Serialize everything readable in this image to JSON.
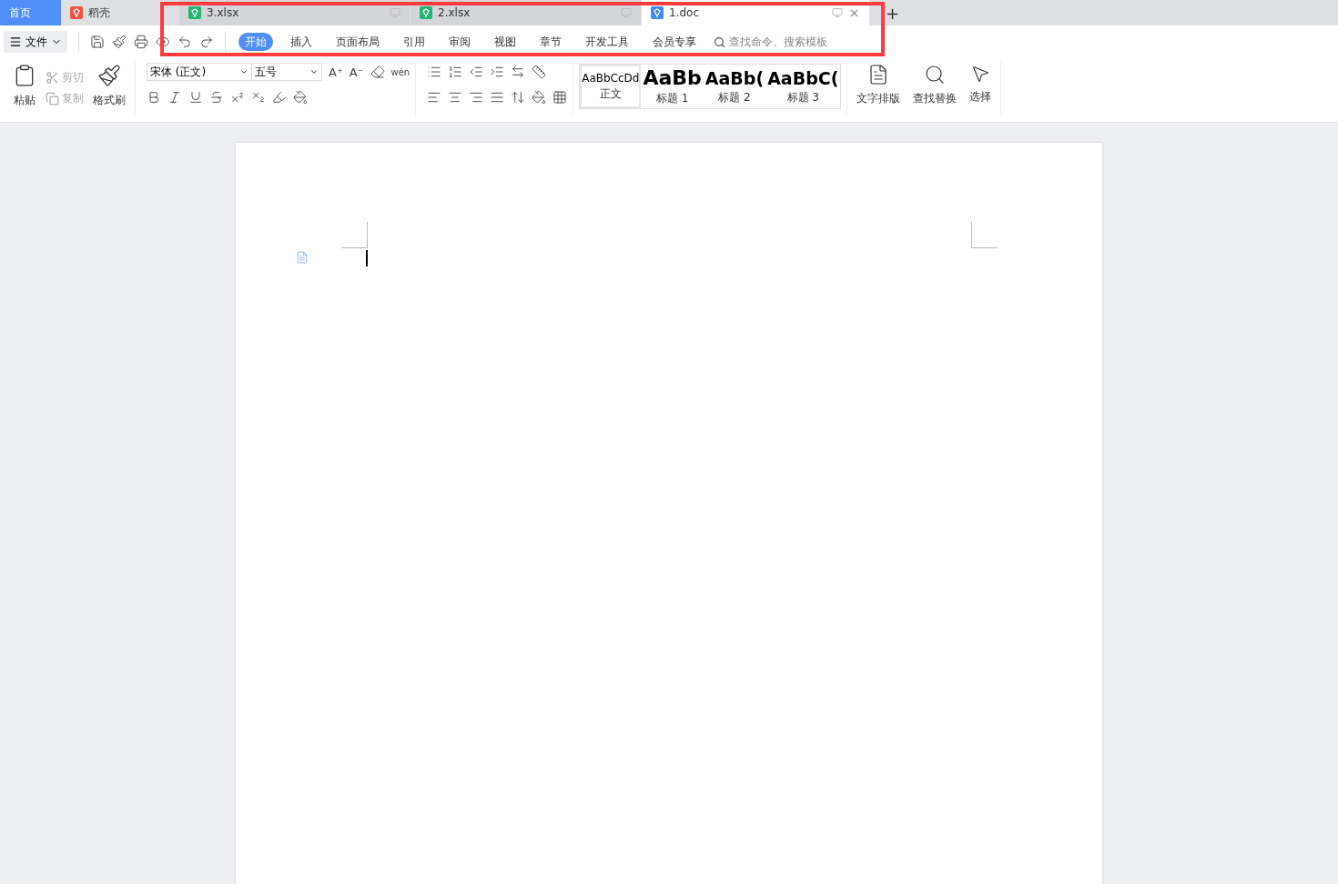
{
  "tabs": [
    {
      "kind": "home",
      "label": "首页",
      "selected": false
    },
    {
      "kind": "app",
      "label": "稻壳",
      "selected": false
    },
    {
      "kind": "sheet",
      "label": "3.xlsx",
      "selected": false
    },
    {
      "kind": "sheet",
      "label": "2.xlsx",
      "selected": false
    },
    {
      "kind": "writer",
      "label": "1.doc",
      "selected": true
    }
  ],
  "new_tab": "+",
  "file_menu": "文件",
  "menu": [
    {
      "label": "开始",
      "selected": true
    },
    {
      "label": "插入",
      "selected": false
    },
    {
      "label": "页面布局",
      "selected": false
    },
    {
      "label": "引用",
      "selected": false
    },
    {
      "label": "审阅",
      "selected": false
    },
    {
      "label": "视图",
      "selected": false
    },
    {
      "label": "章节",
      "selected": false
    },
    {
      "label": "开发工具",
      "selected": false
    },
    {
      "label": "会员专享",
      "selected": false
    }
  ],
  "search": {
    "placeholder": "查找命令、搜索模板"
  },
  "clipboard": {
    "paste": "粘贴",
    "cut": "剪切",
    "copy": "复制",
    "format_painter": "格式刷"
  },
  "font": {
    "name": "宋体 (正文)",
    "size": "五号",
    "phonetic": "wén",
    "grow": "A⁺",
    "shrink": "A⁻"
  },
  "styles": [
    {
      "sample": "AaBbCcDd",
      "label": "正文",
      "selected": true
    },
    {
      "sample": "AaBb",
      "label": "标题 1",
      "selected": false
    },
    {
      "sample": "AaBb(",
      "label": "标题 2",
      "selected": false
    },
    {
      "sample": "AaBbC(",
      "label": "标题 3",
      "selected": false
    }
  ],
  "big_buttons": [
    {
      "label": "文字排版"
    },
    {
      "label": "查找替换"
    },
    {
      "label": "选择"
    }
  ],
  "annotation": {
    "color": "#ff3b3b"
  }
}
